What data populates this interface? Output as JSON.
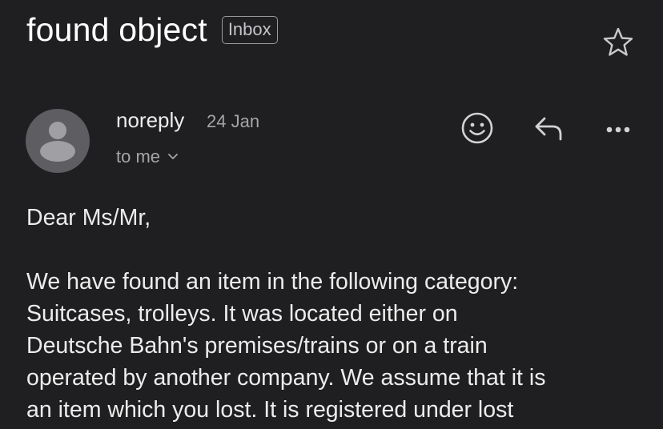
{
  "email": {
    "subject": "found object",
    "label": "Inbox",
    "sender": "noreply",
    "date": "24 Jan",
    "recipient": "to me",
    "greeting": "Dear Ms/Mr,",
    "body_paragraph": "We have found an item in the following category:\nSuitcases, trolleys. It was located either on\nDeutsche Bahn's premises/trains or on a train\noperated by another company. We assume that it is\nan item which you lost. It is registered under lost"
  },
  "icons": {
    "star": "star-icon",
    "emoji": "emoji-icon",
    "reply": "reply-icon",
    "more": "more-icon",
    "avatar": "avatar-icon",
    "chevron": "chevron-down-icon"
  },
  "colors": {
    "background": "#1f1f21",
    "primary_text": "#ffffff",
    "secondary_text": "#a5a5a9",
    "avatar_bg": "#5e5e62"
  }
}
